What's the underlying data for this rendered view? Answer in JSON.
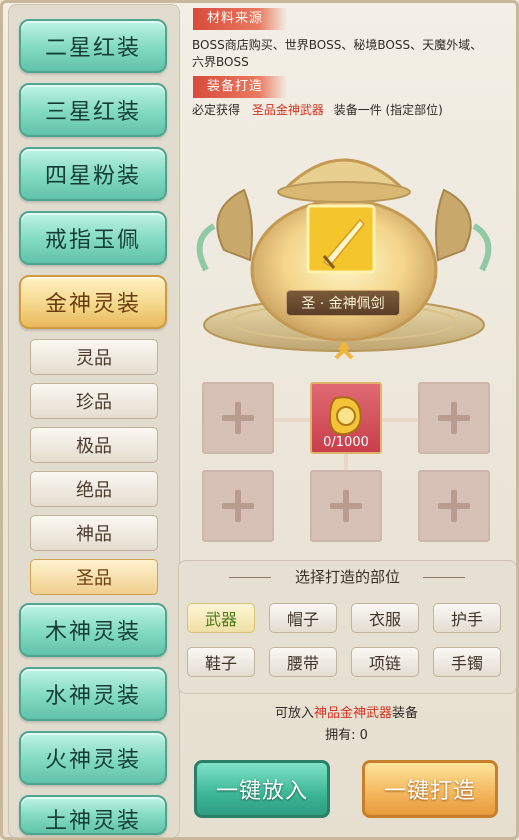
{
  "menu": {
    "items": [
      {
        "label": "二星红装"
      },
      {
        "label": "三星红装"
      },
      {
        "label": "四星粉装"
      },
      {
        "label": "戒指玉佩"
      },
      {
        "label": "金神灵装"
      }
    ],
    "sub_items": [
      {
        "label": "灵品"
      },
      {
        "label": "珍品"
      },
      {
        "label": "极品"
      },
      {
        "label": "绝品"
      },
      {
        "label": "神品"
      },
      {
        "label": "圣品"
      }
    ],
    "more_items": [
      {
        "label": "木神灵装"
      },
      {
        "label": "水神灵装"
      },
      {
        "label": "火神灵装"
      },
      {
        "label": "土神灵装"
      }
    ]
  },
  "source": {
    "title": "材料来源",
    "line1": "BOSS商店购买、世界BOSS、秘境BOSS、天魔外域、",
    "line2": "六界BOSS"
  },
  "forge": {
    "title": "装备打造",
    "desc_prefix": "必定获得",
    "desc_highlight": "圣品金神武器",
    "desc_suffix": "装备一件 (指定部位)"
  },
  "result": {
    "item_name": "圣 · 金神佩剑"
  },
  "material": {
    "count": "0/1000"
  },
  "parts": {
    "title": "选择打造的部位",
    "buttons": [
      {
        "label": "武器"
      },
      {
        "label": "帽子"
      },
      {
        "label": "衣服"
      },
      {
        "label": "护手"
      },
      {
        "label": "鞋子"
      },
      {
        "label": "腰带"
      },
      {
        "label": "项链"
      },
      {
        "label": "手镯"
      }
    ]
  },
  "info": {
    "put_prefix": "可放入",
    "put_highlight": "神品金神武器",
    "put_suffix": "装备",
    "owned": "拥有: 0"
  },
  "actions": {
    "place": "一键放入",
    "forge": "一键打造"
  },
  "colors": {
    "teal": "#6fd6bb",
    "gold": "#f3c56e",
    "accent_red": "#d23323"
  }
}
